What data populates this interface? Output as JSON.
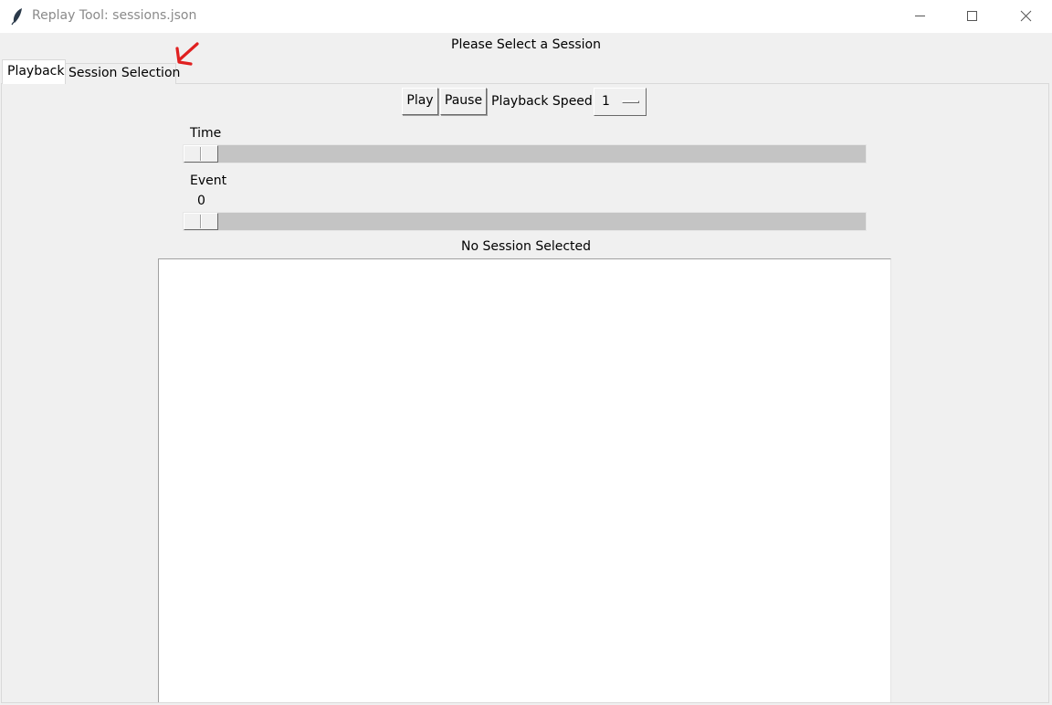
{
  "window": {
    "title": "Replay Tool: sessions.json",
    "icon": "feather-icon",
    "controls": [
      "minimize-icon",
      "maximize-icon",
      "close-icon"
    ]
  },
  "header": {
    "label": "Please Select a Session"
  },
  "tabs": [
    {
      "label": "Playback",
      "selected": true
    },
    {
      "label": "Session Selection",
      "selected": false
    }
  ],
  "annotation": {
    "icon": "red-arrow-icon",
    "color": "#e02020"
  },
  "toolbar": {
    "play_label": "Play",
    "pause_label": "Pause",
    "speed_label": "Playback Speed:",
    "speed_value": "1"
  },
  "time_slider": {
    "label": "Time",
    "value": 0
  },
  "event_slider": {
    "label": "Event",
    "value_text": "0",
    "value": 0
  },
  "status": {
    "text": "No Session Selected"
  }
}
